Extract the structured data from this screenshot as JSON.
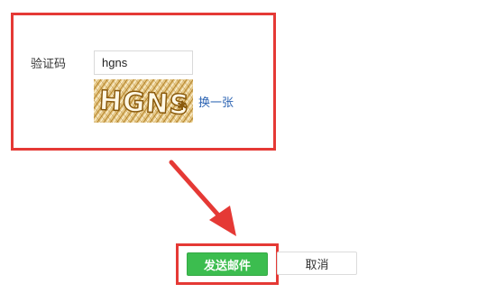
{
  "form": {
    "captcha_label": "验证码",
    "captcha_value": "hgns",
    "captcha_image_text": "HGNS",
    "refresh_link": "换一张"
  },
  "actions": {
    "send_label": "发送邮件",
    "cancel_label": "取消"
  },
  "colors": {
    "annotation_red": "#e53935",
    "send_green": "#3cbd4f",
    "link_blue": "#2d64b3"
  }
}
